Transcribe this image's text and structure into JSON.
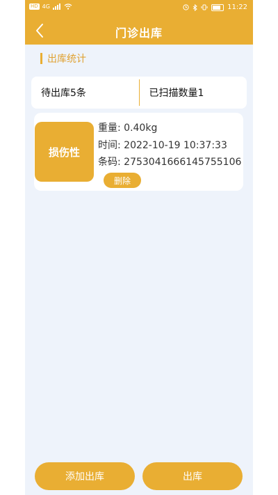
{
  "status_bar": {
    "left_tags": [
      "HD",
      "4G"
    ],
    "battery": "67",
    "time": "11:22"
  },
  "header": {
    "title": "门诊出库",
    "back_icon": "chevron-left-icon"
  },
  "section": {
    "title": "出库统计"
  },
  "stats": {
    "pending": "待出库5条",
    "scanned": "已扫描数量1"
  },
  "items": [
    {
      "category": "损伤性",
      "weight": "重量: 0.40kg",
      "time": "时间: 2022-10-19 10:37:33",
      "barcode": "条码: 2753041666145755106",
      "delete_label": "删除"
    }
  ],
  "actions": {
    "add_label": "添加出库",
    "out_label": "出库"
  },
  "colors": {
    "accent": "#e9ae33",
    "background": "#eef3fb"
  }
}
